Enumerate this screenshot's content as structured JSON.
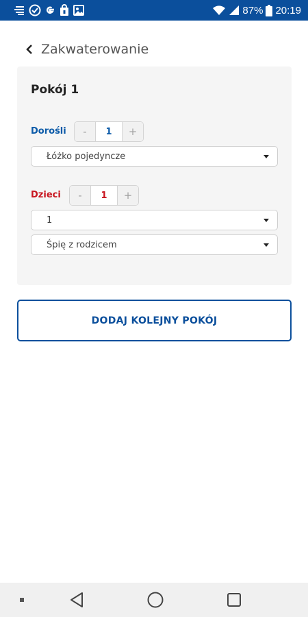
{
  "status_bar": {
    "battery_percent": "87%",
    "time": "20:19",
    "icons_left": [
      "notification-lines-icon",
      "check-circle-icon",
      "google-g-icon",
      "lock-box-icon",
      "image-box-icon"
    ],
    "icons_right": [
      "wifi-icon",
      "signal-icon",
      "battery-icon"
    ]
  },
  "header": {
    "title": "Zakwaterowanie",
    "back_icon": "chevron-left-icon"
  },
  "room": {
    "title": "Pokój 1",
    "adults": {
      "label": "Dorośli",
      "minus": "-",
      "value": "1",
      "plus": "+",
      "bed_select": "Łóżko pojedyncze"
    },
    "children": {
      "label": "Dzieci",
      "minus": "-",
      "value": "1",
      "plus": "+",
      "age_select": "1",
      "sleep_select": "Śpię z rodzicem"
    }
  },
  "add_room_button": "DODAJ KOLEJNY POKÓJ",
  "nav_bar": {
    "icons": [
      "dot-icon",
      "back-triangle-icon",
      "home-circle-icon",
      "recents-square-icon"
    ]
  },
  "colors": {
    "status_bar": "#0b4f9c",
    "adults_accent": "#0b5aa8",
    "children_accent": "#c8141e",
    "card_bg": "#f5f5f5"
  }
}
